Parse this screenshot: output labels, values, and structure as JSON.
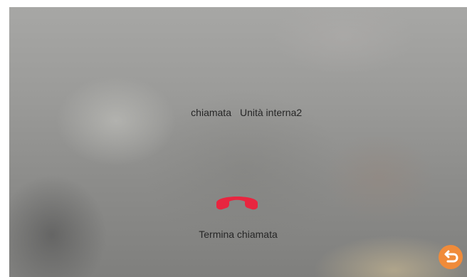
{
  "call": {
    "status": "chiamata",
    "callee": "Unità interna2"
  },
  "hangup": {
    "label": "Termina chiamata",
    "icon": "hangup-phone-icon",
    "color": "#e8253f"
  },
  "back": {
    "icon": "back-arrow-icon",
    "color": "#f08b3a"
  }
}
